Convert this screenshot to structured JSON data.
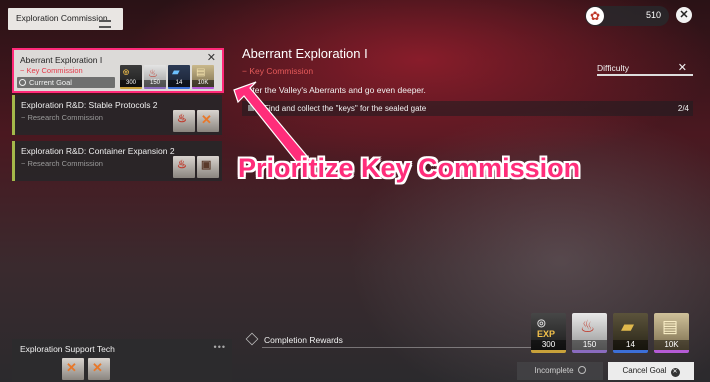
{
  "header": {
    "title": "Exploration Commission",
    "currency_value": "510",
    "currency_icon": "flower-emblem-icon",
    "close_label": "✕"
  },
  "commissions": [
    {
      "title": "Aberrant Exploration I",
      "type": "Key Commission",
      "status": "Current Goal",
      "selected": true,
      "rewards": [
        {
          "icon": "exp-icon",
          "value": "300"
        },
        {
          "icon": "meat-icon",
          "value": "150"
        },
        {
          "icon": "card-icon",
          "value": "14"
        },
        {
          "icon": "ticket-icon",
          "value": "10K"
        }
      ]
    },
    {
      "title": "Exploration R&D: Stable Protocols 2",
      "type": "Research Commission",
      "selected": false
    },
    {
      "title": "Exploration R&D: Container Expansion 2",
      "type": "Research Commission",
      "selected": false
    }
  ],
  "detail": {
    "title": "Aberrant Exploration I",
    "type": "Key Commission",
    "difficulty_label": "Difficulty",
    "description": "Enter the Valley's Aberrants and go even deeper.",
    "objective": {
      "text": "Find and collect the \"keys\" for the sealed gate",
      "progress": "2/4"
    }
  },
  "annotation": {
    "text": "Prioritize Key Commission",
    "color": "#ff2d7a"
  },
  "completion": {
    "label": "Completion Rewards",
    "rewards": [
      {
        "icon": "exp-icon",
        "value": "300",
        "badge": "EXP"
      },
      {
        "icon": "meat-icon",
        "value": "150"
      },
      {
        "icon": "card-icon",
        "value": "14"
      },
      {
        "icon": "ticket-icon",
        "value": "10K"
      }
    ]
  },
  "buttons": {
    "incomplete": "Incomplete",
    "cancel_goal": "Cancel Goal"
  },
  "support_tech": {
    "title": "Exploration Support Tech",
    "more": "•••"
  },
  "colors": {
    "accent_pink": "#ff2a79",
    "key_red": "#e53a4a",
    "research_green": "#a4b84a"
  }
}
